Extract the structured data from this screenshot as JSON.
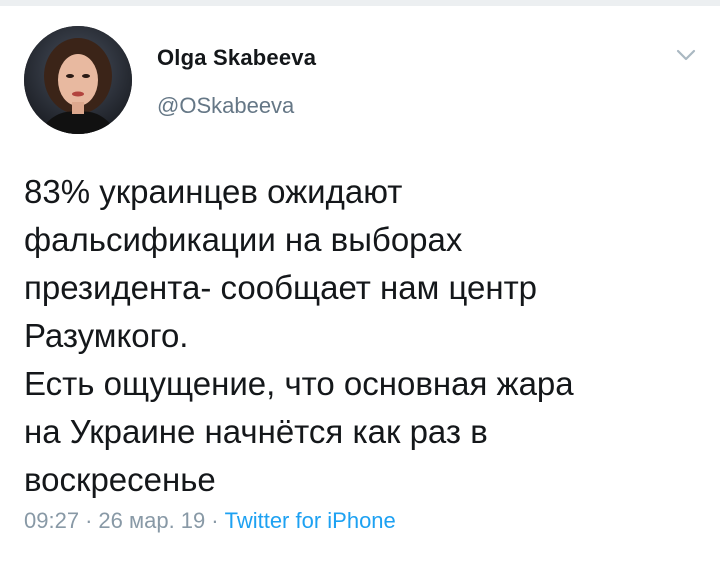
{
  "author": {
    "display_name": "Olga Skabeeva",
    "handle": "@OSkabeeva",
    "avatar_icon": "profile-photo"
  },
  "tweet": {
    "lines": [
      "83% украинцев ожидают",
      "фальсификации на выборах",
      "президента- сообщает нам центр",
      "Разумкого.",
      "Есть ощущение, что основная жара",
      "на Украине начнётся как раз в",
      "воскресенье"
    ]
  },
  "meta": {
    "time": "09:27",
    "date": "26 мар. 19",
    "separator": "·",
    "source": "Twitter for iPhone"
  },
  "colors": {
    "text": "#14171a",
    "secondary": "#657786",
    "link": "#1da1f2",
    "chevron": "#aab8c2"
  }
}
